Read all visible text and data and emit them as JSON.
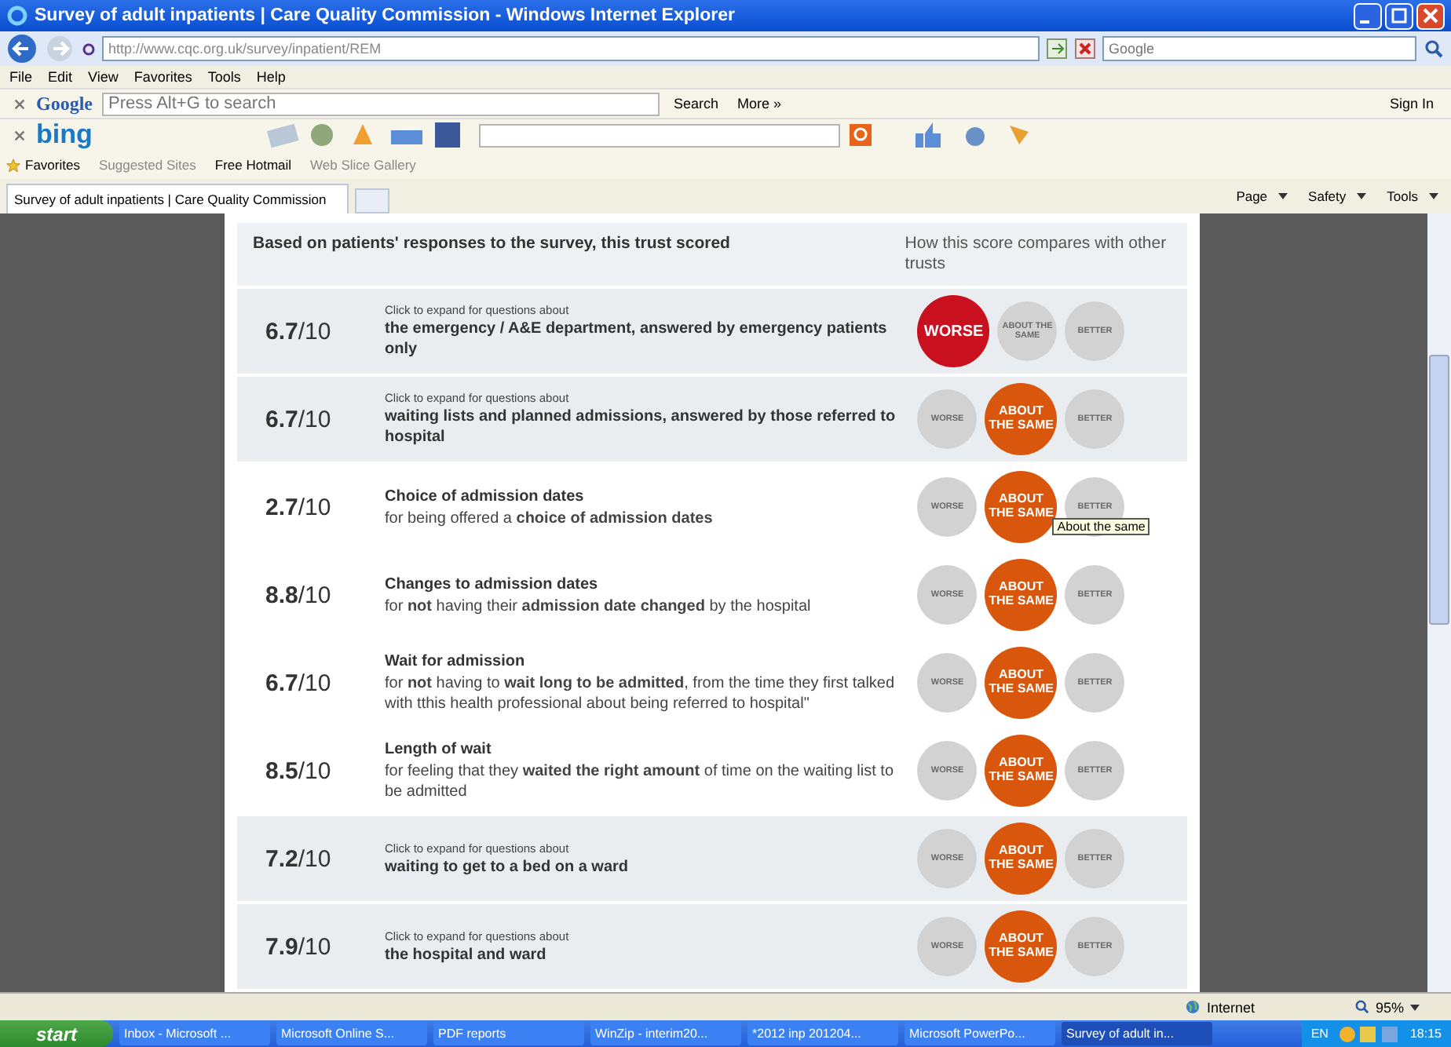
{
  "window": {
    "title": "Survey of adult inpatients | Care Quality Commission - Windows Internet Explorer"
  },
  "address_bar": {
    "value": "http://www.cqc.org.uk/survey/inpatient/REM",
    "search_placeholder": "Google"
  },
  "menu": [
    "File",
    "Edit",
    "View",
    "Favorites",
    "Tools",
    "Help"
  ],
  "google_toolbar": {
    "logo": "Google",
    "placeholder": "Press Alt+G to search",
    "search": "Search",
    "more": "More »",
    "sign_in": "Sign In"
  },
  "bing_toolbar": {
    "logo": "bing"
  },
  "favorites_bar": {
    "label": "Favorites",
    "items": [
      "Suggested Sites",
      "Free Hotmail",
      "Web Slice Gallery"
    ]
  },
  "tab": {
    "title": "Survey of adult inpatients | Care Quality Commission"
  },
  "command_bar": [
    "Page",
    "Safety",
    "Tools"
  ],
  "table": {
    "header_left": "Based on patients' responses to the survey, this trust scored",
    "header_right": "How this score compares with other trusts",
    "rows": [
      {
        "kind": "group",
        "shaded": true,
        "score": "**6.7**/10",
        "lead": "Click to expand for questions about",
        "title": "the emergency / A&E department, answered by emergency patients only",
        "ratings": [
          {
            "kind": "worse",
            "label": "WORSE",
            "selected": true
          },
          {
            "kind": "same",
            "label": "ABOUT THE SAME",
            "selected": false
          },
          {
            "kind": "better",
            "label": "BETTER",
            "selected": false
          }
        ]
      },
      {
        "kind": "group",
        "shaded": true,
        "score": "**6.7**/10",
        "lead": "Click to expand for questions about",
        "title": "waiting lists and planned admissions, answered by those referred to hospital",
        "ratings": [
          {
            "kind": "worse",
            "label": "WORSE",
            "selected": false
          },
          {
            "kind": "same",
            "label": "ABOUT THE SAME",
            "selected": true
          },
          {
            "kind": "better",
            "label": "BETTER",
            "selected": false
          }
        ]
      },
      {
        "kind": "question",
        "shaded": false,
        "score": "**2.7**/10",
        "title": "Choice of admission dates",
        "text": "for being offered a **choice of admission dates**",
        "tooltip": "About the same",
        "ratings": [
          {
            "kind": "worse",
            "label": "WORSE",
            "selected": false
          },
          {
            "kind": "same",
            "label": "ABOUT THE SAME",
            "selected": true
          },
          {
            "kind": "better",
            "label": "BETTER",
            "selected": false
          }
        ]
      },
      {
        "kind": "question",
        "shaded": false,
        "score": "**8.8**/10",
        "title": "Changes to admission dates",
        "text": "for **not** having their **admission date changed** by the hospital",
        "ratings": [
          {
            "kind": "worse",
            "label": "WORSE",
            "selected": false
          },
          {
            "kind": "same",
            "label": "ABOUT THE SAME",
            "selected": true
          },
          {
            "kind": "better",
            "label": "BETTER",
            "selected": false
          }
        ]
      },
      {
        "kind": "question",
        "shaded": false,
        "score": "**6.7**/10",
        "title": "Wait for admission",
        "text": "for **not** having to **wait long to be admitted**, from the time they first talked with tthis health professional about being referred to hospital\"",
        "ratings": [
          {
            "kind": "worse",
            "label": "WORSE",
            "selected": false
          },
          {
            "kind": "same",
            "label": "ABOUT THE SAME",
            "selected": true
          },
          {
            "kind": "better",
            "label": "BETTER",
            "selected": false
          }
        ]
      },
      {
        "kind": "question",
        "shaded": false,
        "score": "**8.5**/10",
        "title": "Length of wait",
        "text": "for feeling that they **waited the right amount** of time on the waiting list to be admitted",
        "ratings": [
          {
            "kind": "worse",
            "label": "WORSE",
            "selected": false
          },
          {
            "kind": "same",
            "label": "ABOUT THE SAME",
            "selected": true
          },
          {
            "kind": "better",
            "label": "BETTER",
            "selected": false
          }
        ]
      },
      {
        "kind": "group",
        "shaded": true,
        "score": "**7.2**/10",
        "lead": "Click to expand for questions about",
        "title": "waiting to get to a bed on a ward",
        "ratings": [
          {
            "kind": "worse",
            "label": "WORSE",
            "selected": false
          },
          {
            "kind": "same",
            "label": "ABOUT THE SAME",
            "selected": true
          },
          {
            "kind": "better",
            "label": "BETTER",
            "selected": false
          }
        ]
      },
      {
        "kind": "group",
        "shaded": true,
        "score": "**7.9**/10",
        "lead": "Click to expand for questions about",
        "title": "the hospital and ward",
        "ratings": [
          {
            "kind": "worse",
            "label": "WORSE",
            "selected": false
          },
          {
            "kind": "same",
            "label": "ABOUT THE SAME",
            "selected": true
          },
          {
            "kind": "better",
            "label": "BETTER",
            "selected": false
          }
        ]
      }
    ]
  },
  "status_bar": {
    "zone": "Internet",
    "zoom": "95%"
  },
  "taskbar": {
    "start": "start",
    "items": [
      {
        "label": "Inbox - Microsoft ...",
        "selected": false
      },
      {
        "label": "Microsoft Online S...",
        "selected": false
      },
      {
        "label": "PDF reports",
        "selected": false
      },
      {
        "label": "WinZip - interim20...",
        "selected": false
      },
      {
        "label": "*2012 inp 201204...",
        "selected": false
      },
      {
        "label": "Microsoft PowerPo...",
        "selected": false
      },
      {
        "label": "Survey of adult in...",
        "selected": true
      }
    ],
    "language": "EN",
    "clock": "18:15"
  }
}
